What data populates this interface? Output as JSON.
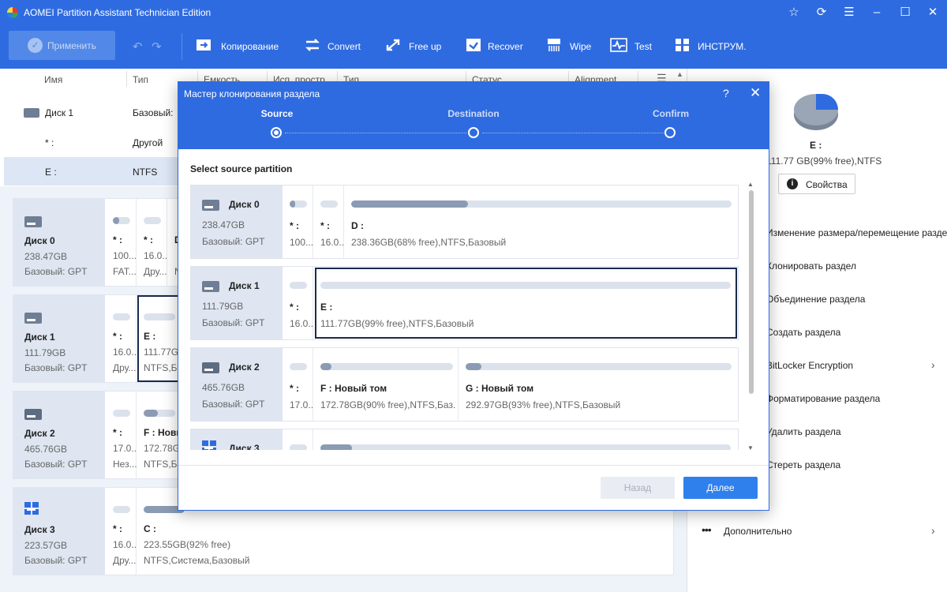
{
  "window": {
    "title": "AOMEI Partition Assistant Technician Edition"
  },
  "toolbar": {
    "apply": "Применить",
    "items": [
      "Копирование",
      "Convert",
      "Free up",
      "Recover",
      "Wipe",
      "Test",
      "ИНСТРУМ."
    ]
  },
  "columns": [
    "Имя",
    "Тип",
    "Емкость",
    "Исп. простр.",
    "Тип",
    "Статус",
    "Alignment"
  ],
  "table": [
    {
      "name": "Диск 1",
      "type": "Базовый:"
    },
    {
      "name": "* :",
      "type": "Другой"
    },
    {
      "name": "E :",
      "type": "NTFS"
    }
  ],
  "disks": [
    {
      "name": "Диск 0",
      "size": "238.47GB",
      "type": "Базовый: GPT",
      "parts": [
        {
          "n": "* :",
          "i": "100...",
          "t": "FAT..."
        },
        {
          "n": "* :",
          "i": "16.0...",
          "t": "Дру..."
        },
        {
          "n": "D",
          "i": "",
          "t": "N"
        }
      ]
    },
    {
      "name": "Диск 1",
      "size": "111.79GB",
      "type": "Базовый: GPT",
      "parts": [
        {
          "n": "* :",
          "i": "16.0...",
          "t": "Дру..."
        },
        {
          "n": "E :",
          "i": "111.77G",
          "t": "NTFS,Ба"
        }
      ]
    },
    {
      "name": "Диск 2",
      "size": "465.76GB",
      "type": "Базовый: GPT",
      "parts": [
        {
          "n": "* :",
          "i": "17.0...",
          "t": "Нез..."
        },
        {
          "n": "F : Новы",
          "i": "172.78G",
          "t": "NTFS,Ба"
        }
      ]
    },
    {
      "name": "Диск 3",
      "size": "223.57GB",
      "type": "Базовый: GPT",
      "parts": [
        {
          "n": "* :",
          "i": "16.0...",
          "t": "Дру..."
        },
        {
          "n": "C :",
          "i": "223.55GB(92% free)",
          "t": "NTFS,Система,Базовый"
        }
      ]
    }
  ],
  "right_panel": {
    "drive": "E :",
    "info": "111.77 GB(99% free),NTFS",
    "props": "Свойства",
    "ops": [
      "Изменение размера/перемещение разделов",
      "Клонировать раздел",
      "Объединение раздела",
      "Создать раздела",
      "BitLocker Encryption",
      "Форматирование раздела",
      "Удалить раздела",
      "Стереть раздела",
      "Дополнительно"
    ]
  },
  "modal": {
    "title": "Мастер клонирования раздела",
    "help": "?",
    "close": "✕",
    "steps": [
      "Source",
      "Destination",
      "Confirm"
    ],
    "label": "Select source partition",
    "disks": [
      {
        "name": "Диск 0",
        "size": "238.47GB",
        "type": "Базовый: GPT",
        "parts": [
          {
            "n": "* :",
            "i": "100..."
          },
          {
            "n": "* :",
            "i": "16.0..."
          },
          {
            "n": "D :",
            "i": "238.36GB(68% free),NTFS,Базовый"
          }
        ]
      },
      {
        "name": "Диск 1",
        "size": "111.79GB",
        "type": "Базовый: GPT",
        "parts": [
          {
            "n": "* :",
            "i": "16.0..."
          },
          {
            "n": "E :",
            "i": "111.77GB(99% free),NTFS,Базовый"
          }
        ]
      },
      {
        "name": "Диск 2",
        "size": "465.76GB",
        "type": "Базовый: GPT",
        "parts": [
          {
            "n": "* :",
            "i": "17.0..."
          },
          {
            "n": "F : Новый том",
            "i": "172.78GB(90% free),NTFS,Баз..."
          },
          {
            "n": "G : Новый том",
            "i": "292.97GB(93% free),NTFS,Базовый"
          }
        ]
      },
      {
        "name": "Диск 3"
      }
    ],
    "back": "Назад",
    "next": "Далее"
  },
  "colors": {
    "accent": "#2f6be0",
    "button": "#2f80ed"
  }
}
